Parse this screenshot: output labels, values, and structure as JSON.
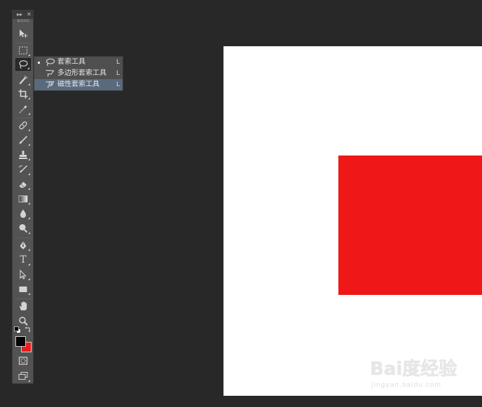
{
  "colors": {
    "workspace": "#282828",
    "toolbar": "#535353",
    "foreground": "#000000",
    "background": "#e81d1d",
    "canvas": "#ffffff",
    "shape": "#ef1717",
    "menu_highlight": "#5a6a7d"
  },
  "toolbar": {
    "collapse_icon": "double-chevron-icon",
    "close_icon": "close-icon",
    "type_tool_glyph": "T",
    "tools": [
      {
        "name": "move-tool",
        "icon": "move-icon"
      },
      {
        "name": "rectangular-marquee-tool",
        "icon": "marquee-icon"
      },
      {
        "name": "lasso-tool",
        "icon": "lasso-icon",
        "active": true
      },
      {
        "name": "quick-selection-tool",
        "icon": "quick-selection-icon"
      },
      {
        "name": "crop-tool",
        "icon": "crop-icon"
      },
      {
        "name": "eyedropper-tool",
        "icon": "eyedropper-icon"
      },
      {
        "name": "spot-healing-tool",
        "icon": "bandage-icon"
      },
      {
        "name": "brush-tool",
        "icon": "brush-icon"
      },
      {
        "name": "clone-stamp-tool",
        "icon": "stamp-icon"
      },
      {
        "name": "history-brush-tool",
        "icon": "history-brush-icon"
      },
      {
        "name": "eraser-tool",
        "icon": "eraser-icon"
      },
      {
        "name": "gradient-tool",
        "icon": "gradient-icon"
      },
      {
        "name": "blur-tool",
        "icon": "drop-icon"
      },
      {
        "name": "dodge-tool",
        "icon": "dodge-icon"
      },
      {
        "name": "pen-tool",
        "icon": "pen-icon"
      },
      {
        "name": "type-tool",
        "icon": "type-icon"
      },
      {
        "name": "path-selection-tool",
        "icon": "arrow-icon"
      },
      {
        "name": "rectangle-tool",
        "icon": "rectangle-icon"
      },
      {
        "name": "hand-tool",
        "icon": "hand-icon"
      },
      {
        "name": "zoom-tool",
        "icon": "magnifier-icon"
      },
      {
        "name": "quick-mask",
        "icon": "quick-mask-icon"
      },
      {
        "name": "screen-mode",
        "icon": "screen-mode-icon"
      }
    ]
  },
  "flyout": {
    "items": [
      {
        "label": "套索工具",
        "shortcut": "L",
        "checked": true,
        "highlighted": false
      },
      {
        "label": "多边形套索工具",
        "shortcut": "L",
        "checked": false,
        "highlighted": false
      },
      {
        "label": "磁性套索工具",
        "shortcut": "L",
        "checked": false,
        "highlighted": true
      }
    ]
  },
  "watermark": {
    "brand": "Bai度经验",
    "url": "jingyan.baidu.com"
  }
}
